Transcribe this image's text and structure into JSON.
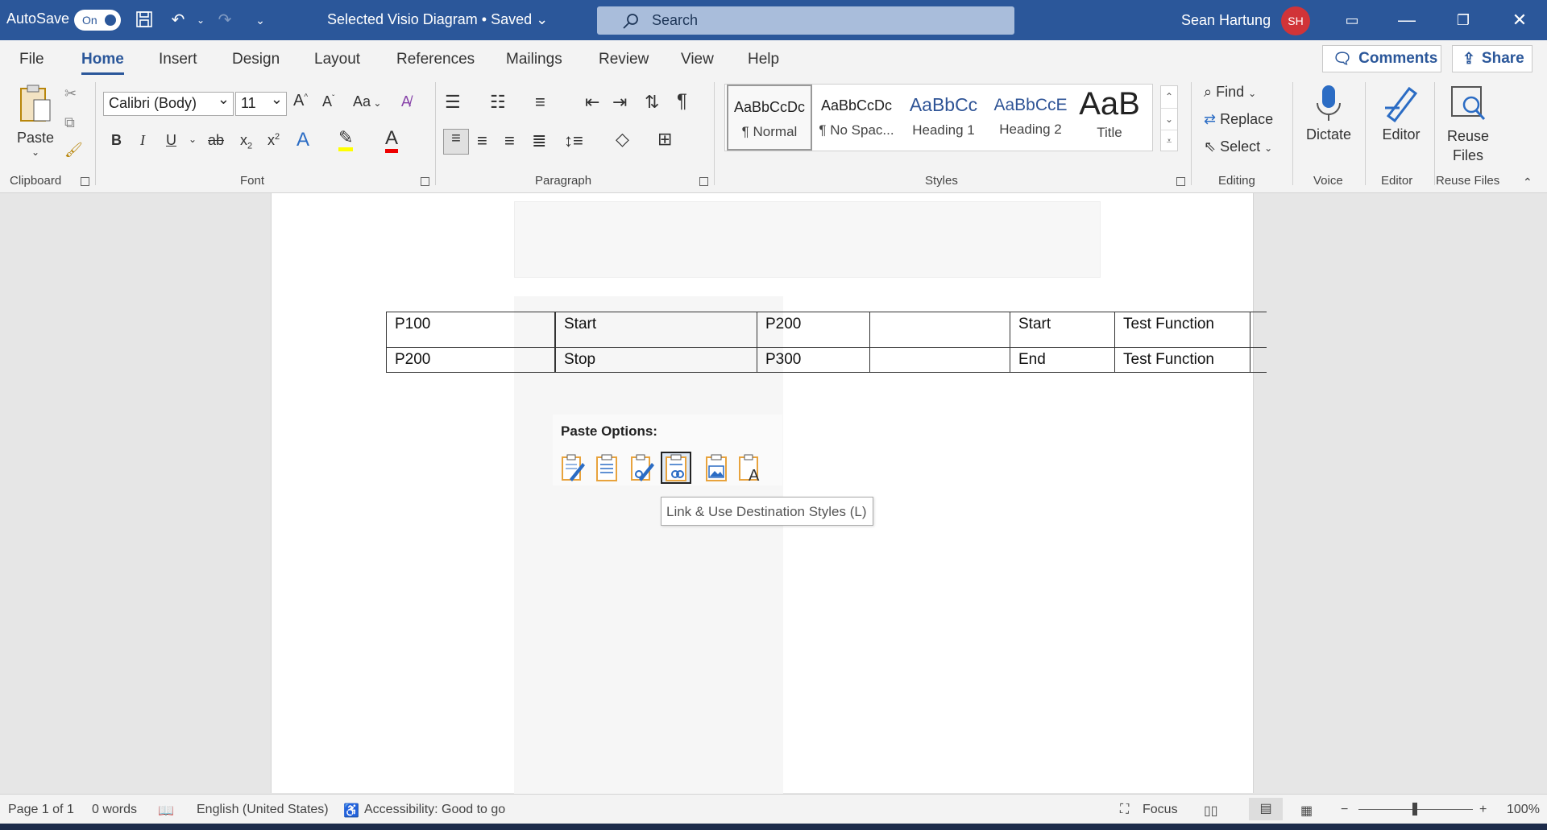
{
  "titlebar": {
    "autosave_label": "AutoSave",
    "autosave_state": "On",
    "doc_title": "Selected Visio Diagram • Saved",
    "search_placeholder": "Search",
    "user_name": "Sean Hartung",
    "user_initials": "SH"
  },
  "menu": {
    "tabs": [
      "File",
      "Home",
      "Insert",
      "Design",
      "Layout",
      "References",
      "Mailings",
      "Review",
      "View",
      "Help"
    ],
    "active_tab": "Home",
    "comments_label": "Comments",
    "share_label": "Share"
  },
  "ribbon": {
    "clipboard": {
      "label": "Clipboard",
      "paste_label": "Paste"
    },
    "font": {
      "label": "Font",
      "font_name": "Calibri (Body)",
      "font_size": "11",
      "bold": "B",
      "italic": "I",
      "underline": "U",
      "strike": "ab",
      "aa": "Aa"
    },
    "paragraph": {
      "label": "Paragraph"
    },
    "styles": {
      "label": "Styles",
      "items": [
        {
          "preview": "AaBbCcDc",
          "name": "¶ Normal"
        },
        {
          "preview": "AaBbCcDc",
          "name": "¶ No Spac..."
        },
        {
          "preview": "AaBbCc",
          "name": "Heading 1"
        },
        {
          "preview": "AaBbCcE",
          "name": "Heading 2"
        },
        {
          "preview": "AaB",
          "name": "Title"
        }
      ]
    },
    "editing": {
      "label": "Editing",
      "find": "Find",
      "replace": "Replace",
      "select": "Select"
    },
    "voice": {
      "label": "Voice",
      "dictate": "Dictate"
    },
    "editor": {
      "label": "Editor",
      "editor": "Editor"
    },
    "reuse": {
      "label": "Reuse Files",
      "button": "Reuse Files"
    }
  },
  "document": {
    "table": [
      [
        "P100",
        "",
        "Start",
        "P200",
        "",
        "Start",
        "Test Function",
        ""
      ],
      [
        "P200",
        "",
        "Stop",
        "P300",
        "",
        "End",
        "Test Function",
        ""
      ]
    ],
    "paste_options_title": "Paste Options:",
    "paste_icons": [
      "keep-source-formatting-icon",
      "use-destination-styles-icon",
      "link-keep-source-icon",
      "link-destination-styles-icon",
      "picture-icon",
      "keep-text-only-icon"
    ],
    "tooltip": "Link & Use Destination Styles (L)"
  },
  "status": {
    "page": "Page 1 of 1",
    "words": "0 words",
    "language": "English (United States)",
    "accessibility": "Accessibility: Good to go",
    "focus": "Focus",
    "zoom": "100%"
  }
}
